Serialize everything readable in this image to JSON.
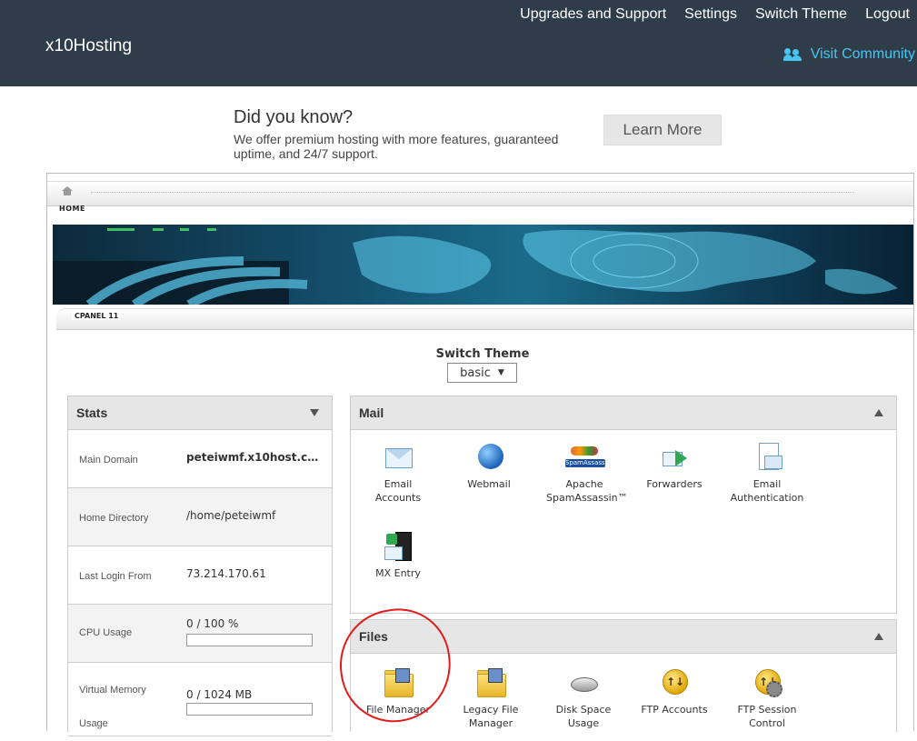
{
  "header": {
    "brand": "x10Hosting",
    "nav": [
      "Upgrades and Support",
      "Settings",
      "Switch Theme",
      "Logout"
    ],
    "community_link": "Visit Community",
    "community_icon": "users-icon",
    "colors": {
      "bar": "#2f3d4a",
      "link": "#46c6f0"
    }
  },
  "promo": {
    "title": "Did you know?",
    "text": "We offer premium hosting with more features, guaranteed uptime, and 24/7 support.",
    "button": "Learn More"
  },
  "cpanel": {
    "home_label": "HOME",
    "cpanel_label": "CPANEL 11",
    "switch_theme": {
      "label": "Switch Theme",
      "selected": "basic"
    }
  },
  "stats": {
    "title": "Stats",
    "rows": [
      {
        "label": "Main Domain",
        "value": "peteiwmf.x10host.co..."
      },
      {
        "label": "Home Directory",
        "value": "/home/peteiwmf"
      },
      {
        "label": "Last Login From",
        "value": "73.214.170.61"
      },
      {
        "label": "CPU Usage",
        "value": "0 / 100 %",
        "fill": 0
      },
      {
        "label": "Virtual Memory Usage",
        "value": "0 / 1024 MB",
        "fill": 0
      }
    ]
  },
  "mail": {
    "title": "Mail",
    "apps": [
      {
        "label": "Email Accounts",
        "icon": "envelope-icon"
      },
      {
        "label": "Webmail",
        "icon": "globe-icon"
      },
      {
        "label": "Apache SpamAssassin™",
        "icon": "spamassassin-icon",
        "badge": "SpamAssassin"
      },
      {
        "label": "Forwarders",
        "icon": "forward-envelope-icon"
      },
      {
        "label": "Email Authentication",
        "icon": "email-auth-icon"
      },
      {
        "label": "MX Entry",
        "icon": "mx-server-icon"
      }
    ]
  },
  "files": {
    "title": "Files",
    "apps": [
      {
        "label": "File Manager",
        "icon": "folder-icon"
      },
      {
        "label": "Legacy File Manager",
        "icon": "folder-icon"
      },
      {
        "label": "Disk Space Usage",
        "icon": "disk-icon"
      },
      {
        "label": "FTP Accounts",
        "icon": "ftp-icon",
        "glyph": "↑↓"
      },
      {
        "label": "FTP Session Control",
        "icon": "ftp-session-icon",
        "glyph": "↑↓"
      }
    ]
  }
}
